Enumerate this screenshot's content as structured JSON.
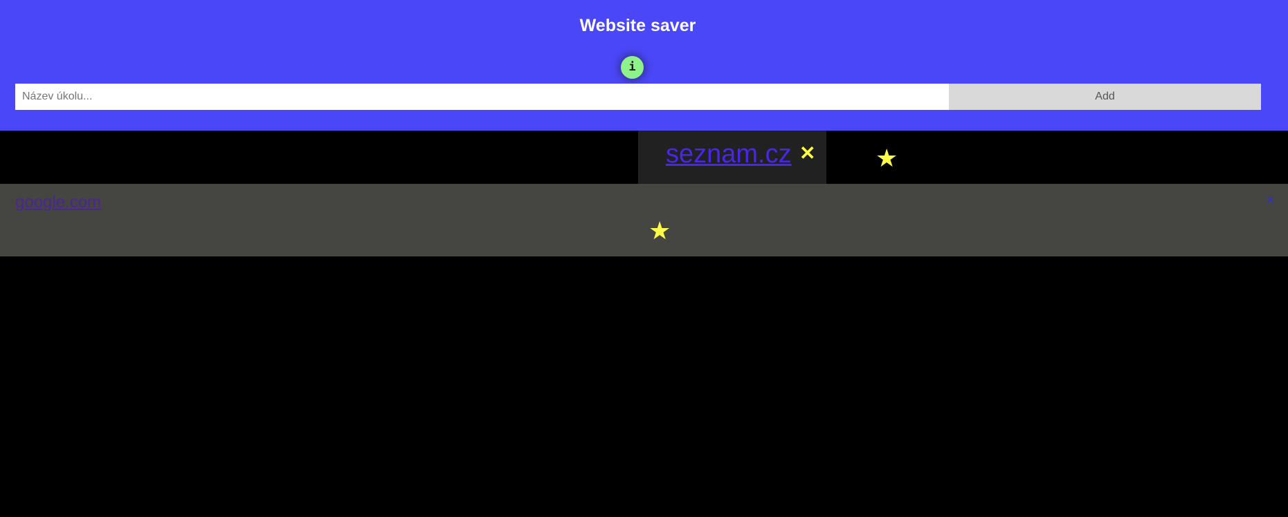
{
  "header": {
    "title": "Website saver",
    "info_icon_glyph": "i",
    "info_icon": "info-icon",
    "background": "#4a47f8"
  },
  "form": {
    "input_placeholder": "Název úkolu...",
    "input_value": "",
    "add_label": "Add"
  },
  "items": [
    {
      "link": "seznam.cz",
      "close_glyph": "✕",
      "star_glyph": "★",
      "favorite": true
    },
    {
      "link": "google.com",
      "close_glyph": "×",
      "star_glyph": "★",
      "favorite": true
    }
  ],
  "colors": {
    "accent": "#4a47f8",
    "info_button": "#8ef28a",
    "star": "#ffff4a",
    "item_dark": "#212121",
    "item_gray": "#454541"
  }
}
